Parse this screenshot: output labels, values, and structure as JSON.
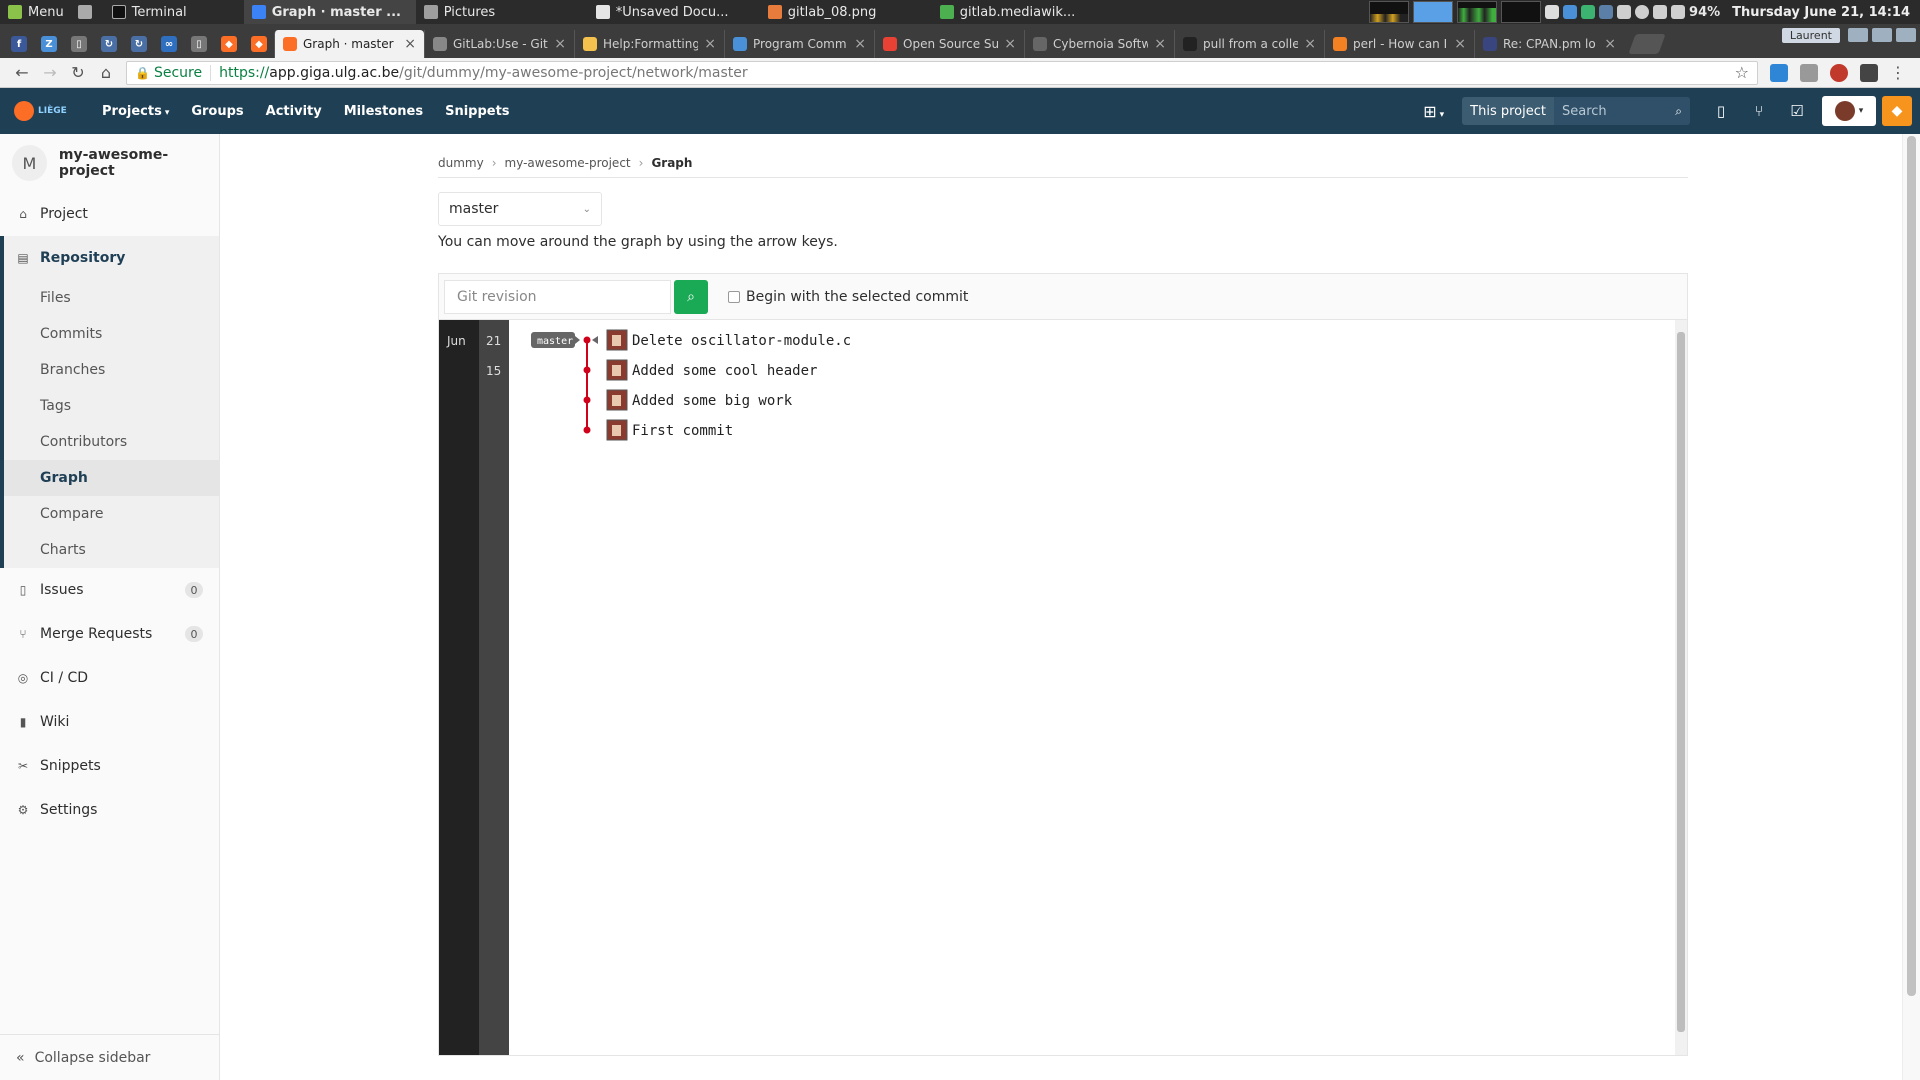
{
  "os": {
    "menu": "Menu",
    "windows": [
      {
        "label": "Terminal",
        "icon": "terminal-icon",
        "cls": "os-term",
        "active": false
      },
      {
        "label": "Graph · master ...",
        "icon": "chrome-icon",
        "cls": "os-chrome",
        "active": true
      },
      {
        "label": "Pictures",
        "icon": "folder-icon",
        "cls": "os-files",
        "active": false
      },
      {
        "label": "*Unsaved Docu...",
        "icon": "text-editor-icon",
        "cls": "os-doc",
        "active": false
      },
      {
        "label": "gitlab_08.png",
        "icon": "image-viewer-icon",
        "cls": "os-img",
        "active": false
      },
      {
        "label": "gitlab.mediawik...",
        "icon": "web-icon",
        "cls": "os-web",
        "active": false
      }
    ],
    "battery": "94%",
    "clock": "Thursday June 21, 14:14"
  },
  "browser": {
    "pinned_tabs": [
      {
        "icon": "facebook-icon",
        "glyph": "f",
        "color": "#3b5998"
      },
      {
        "icon": "zotero-icon",
        "glyph": "Z",
        "color": "#4a90d9"
      },
      {
        "icon": "document-icon",
        "glyph": "▯",
        "color": "#777777"
      },
      {
        "icon": "sync-icon",
        "glyph": "↻",
        "color": "#4a6fa5"
      },
      {
        "icon": "sync-icon",
        "glyph": "↻",
        "color": "#4a6fa5"
      },
      {
        "icon": "infinity-icon",
        "glyph": "∞",
        "color": "#2f6fbf"
      },
      {
        "icon": "document-icon",
        "glyph": "▯",
        "color": "#777777"
      },
      {
        "icon": "gitlab-icon",
        "glyph": "◆",
        "color": "#fc6d26"
      },
      {
        "icon": "gitlab-icon",
        "glyph": "◆",
        "color": "#fc6d26"
      }
    ],
    "tabs": [
      {
        "title": "Graph · master",
        "favicon": "gitlab-icon",
        "color": "#fc6d26",
        "active": true
      },
      {
        "title": "GitLab:Use - Git",
        "favicon": "mediawiki-icon",
        "color": "#888888",
        "active": false
      },
      {
        "title": "Help:Formatting",
        "favicon": "mediawiki-icon",
        "color": "#f2c14e",
        "active": false
      },
      {
        "title": "Program Comm",
        "favicon": "document-icon",
        "color": "#4a90d9",
        "active": false
      },
      {
        "title": "Open Source Su",
        "favicon": "google-icon",
        "color": "#e94235",
        "active": false
      },
      {
        "title": "Cybernoia Softw",
        "favicon": "globe-icon",
        "color": "#666666",
        "active": false
      },
      {
        "title": "pull from a colle",
        "favicon": "github-icon",
        "color": "#222222",
        "active": false
      },
      {
        "title": "perl - How can I",
        "favicon": "stackoverflow-icon",
        "color": "#f48024",
        "active": false
      },
      {
        "title": "Re: CPAN.pm lo",
        "favicon": "perl-icon",
        "color": "#39457e",
        "active": false
      }
    ],
    "profile": "Laurent",
    "secure_label": "Secure",
    "url_scheme": "https://",
    "url_host": "app.giga.ulg.ac.be",
    "url_path": "/git/dummy/my-awesome-project/network/master"
  },
  "gitlab": {
    "logo_text": "LIÈGE",
    "nav": [
      "Projects",
      "Groups",
      "Activity",
      "Milestones",
      "Snippets"
    ],
    "search_scope": "This project",
    "search_placeholder": "Search"
  },
  "sidebar": {
    "project_initial": "M",
    "project_name": "my-awesome-project",
    "items_top": [
      {
        "label": "Project",
        "icon": "home-icon",
        "glyph": "⌂"
      }
    ],
    "repository": {
      "label": "Repository",
      "icon": "book-icon",
      "glyph": "▤",
      "subitems": [
        "Files",
        "Commits",
        "Branches",
        "Tags",
        "Contributors",
        "Graph",
        "Compare",
        "Charts"
      ],
      "active_sub": "Graph"
    },
    "items_bottom": [
      {
        "label": "Issues",
        "icon": "issues-icon",
        "glyph": "▯",
        "badge": "0"
      },
      {
        "label": "Merge Requests",
        "icon": "merge-request-icon",
        "glyph": "⑂",
        "badge": "0"
      },
      {
        "label": "CI / CD",
        "icon": "rocket-icon",
        "glyph": "◎",
        "badge": null
      },
      {
        "label": "Wiki",
        "icon": "wiki-icon",
        "glyph": "▮",
        "badge": null
      },
      {
        "label": "Snippets",
        "icon": "scissors-icon",
        "glyph": "✂",
        "badge": null
      },
      {
        "label": "Settings",
        "icon": "gear-icon",
        "glyph": "⚙",
        "badge": null
      }
    ],
    "collapse_label": "Collapse sidebar"
  },
  "main": {
    "breadcrumb": [
      "dummy",
      "my-awesome-project",
      "Graph"
    ],
    "branch": "master",
    "hint": "You can move around the graph by using the arrow keys.",
    "revision_placeholder": "Git revision",
    "begin_with_selected": "Begin with the selected commit",
    "graph": {
      "month": "Jun",
      "branch_tag": "master",
      "commits": [
        {
          "day": "21",
          "message": "Delete oscillator-module.c"
        },
        {
          "day": "15",
          "message": "Added some cool header"
        },
        {
          "day": "",
          "message": "Added some big work"
        },
        {
          "day": "",
          "message": "First commit"
        }
      ],
      "line_color": "#d0021b"
    }
  }
}
